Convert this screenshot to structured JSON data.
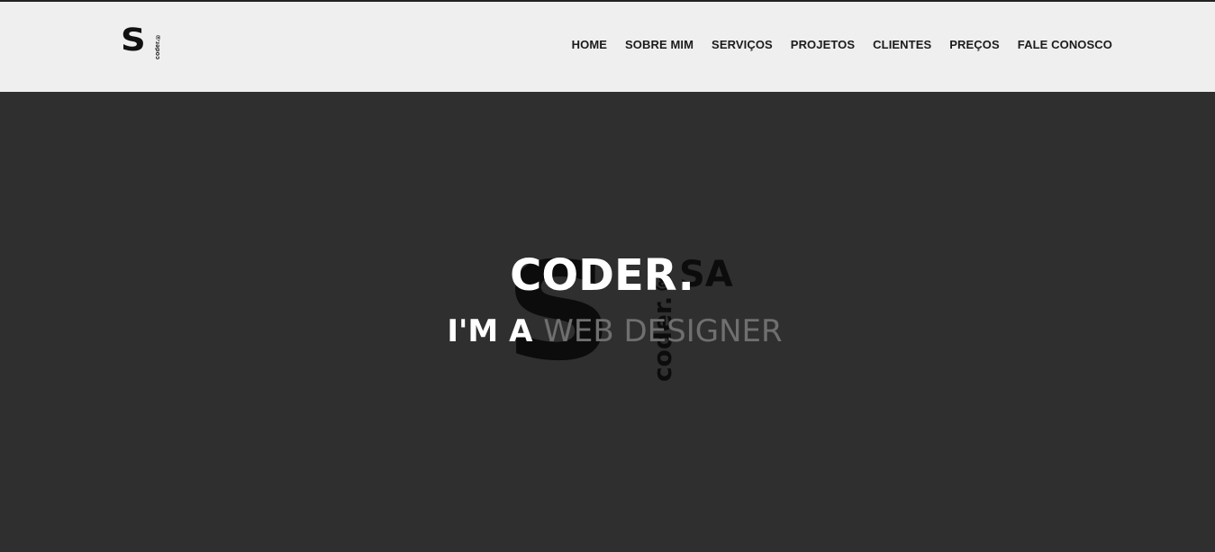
{
  "brand": {
    "logo_letter": "S",
    "logo_word": "coder.®"
  },
  "nav": {
    "items": [
      {
        "label": "HOME"
      },
      {
        "label": "SOBRE MIM"
      },
      {
        "label": "SERVIÇOS"
      },
      {
        "label": "PROJETOS"
      },
      {
        "label": "CLIENTES"
      },
      {
        "label": "PREÇOS"
      },
      {
        "label": "FALE CONOSCO"
      }
    ]
  },
  "hero": {
    "title": "CODER.",
    "subtitle_lead": "I'M A",
    "subtitle_role": "WEB DESIGNER",
    "background_logo": {
      "letter": "S",
      "vertical_word": "coder.®",
      "suffix": "SA"
    }
  },
  "colors": {
    "header_bg": "#efefef",
    "hero_bg": "#2f2f2f",
    "nav_text": "#1b1b1b",
    "title_text": "#ffffff",
    "role_text": "#6f6f6f",
    "logo_dark": "#0c0c0c"
  }
}
